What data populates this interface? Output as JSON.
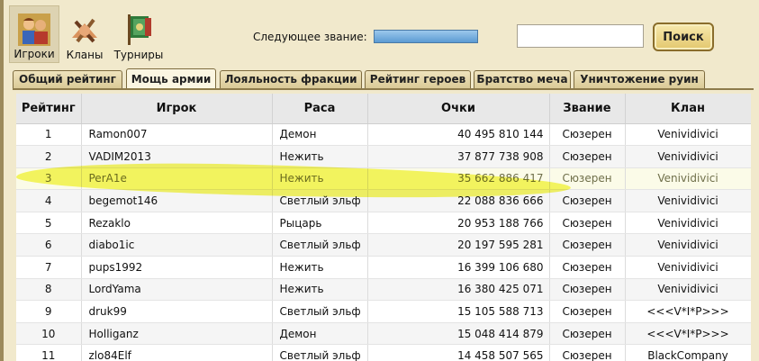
{
  "nav": {
    "players": {
      "label": "Игроки",
      "icon": "players-icon"
    },
    "clans": {
      "label": "Кланы",
      "icon": "clans-icon"
    },
    "tournaments": {
      "label": "Турниры",
      "icon": "tournaments-icon"
    }
  },
  "header": {
    "next_rank_label": "Следующее звание:",
    "search_placeholder": "",
    "search_button": "Поиск"
  },
  "tabs": [
    {
      "label": "Общий рейтинг",
      "active": false
    },
    {
      "label": "Мощь армии",
      "active": true
    },
    {
      "label": "Лояльность фракции",
      "active": false
    },
    {
      "label": "Рейтинг героев",
      "active": false
    },
    {
      "label": "Братство меча",
      "active": false
    },
    {
      "label": "Уничтожение руин",
      "active": false
    }
  ],
  "table": {
    "columns": [
      "Рейтинг",
      "Игрок",
      "Раса",
      "Очки",
      "Звание",
      "Клан"
    ],
    "rows": [
      {
        "rank": "1",
        "player": "Ramon007",
        "race": "Демон",
        "points": "40 495 810 144",
        "title": "Сюзерен",
        "clan": "Venividivici"
      },
      {
        "rank": "2",
        "player": "VADIM2013",
        "race": "Нежить",
        "points": "37 877 738 908",
        "title": "Сюзерен",
        "clan": "Venividivici"
      },
      {
        "rank": "3",
        "player": "PerA1e",
        "race": "Нежить",
        "points": "35 662 886 417",
        "title": "Сюзерен",
        "clan": "Venividivici"
      },
      {
        "rank": "4",
        "player": "begemot146",
        "race": "Светлый эльф",
        "points": "22 088 836 666",
        "title": "Сюзерен",
        "clan": "Venividivici"
      },
      {
        "rank": "5",
        "player": "Rezaklo",
        "race": "Рыцарь",
        "points": "20 953 188 766",
        "title": "Сюзерен",
        "clan": "Venividivici"
      },
      {
        "rank": "6",
        "player": "diabo1ic",
        "race": "Светлый эльф",
        "points": "20 197 595 281",
        "title": "Сюзерен",
        "clan": "Venividivici"
      },
      {
        "rank": "7",
        "player": "pups1992",
        "race": "Нежить",
        "points": "16 399 106 680",
        "title": "Сюзерен",
        "clan": "Venividivici"
      },
      {
        "rank": "8",
        "player": "LordYama",
        "race": "Нежить",
        "points": "16 380 425 071",
        "title": "Сюзерен",
        "clan": "Venividivici"
      },
      {
        "rank": "9",
        "player": "druk99",
        "race": "Светлый эльф",
        "points": "15 105 588 713",
        "title": "Сюзерен",
        "clan": "<<<V*I*P>>>"
      },
      {
        "rank": "10",
        "player": "Holliganz",
        "race": "Демон",
        "points": "15 048 414 879",
        "title": "Сюзерен",
        "clan": "<<<V*I*P>>>"
      },
      {
        "rank": "11",
        "player": "zlo84Elf",
        "race": "Светлый эльф",
        "points": "14 458 507 565",
        "title": "Сюзерен",
        "clan": "BlackCompany"
      }
    ],
    "highlighted_rank": "3"
  },
  "colors": {
    "page_bg": "#f1e9cc",
    "highlight": "#f3f53c",
    "rank_bar": "#5c9bd3"
  }
}
